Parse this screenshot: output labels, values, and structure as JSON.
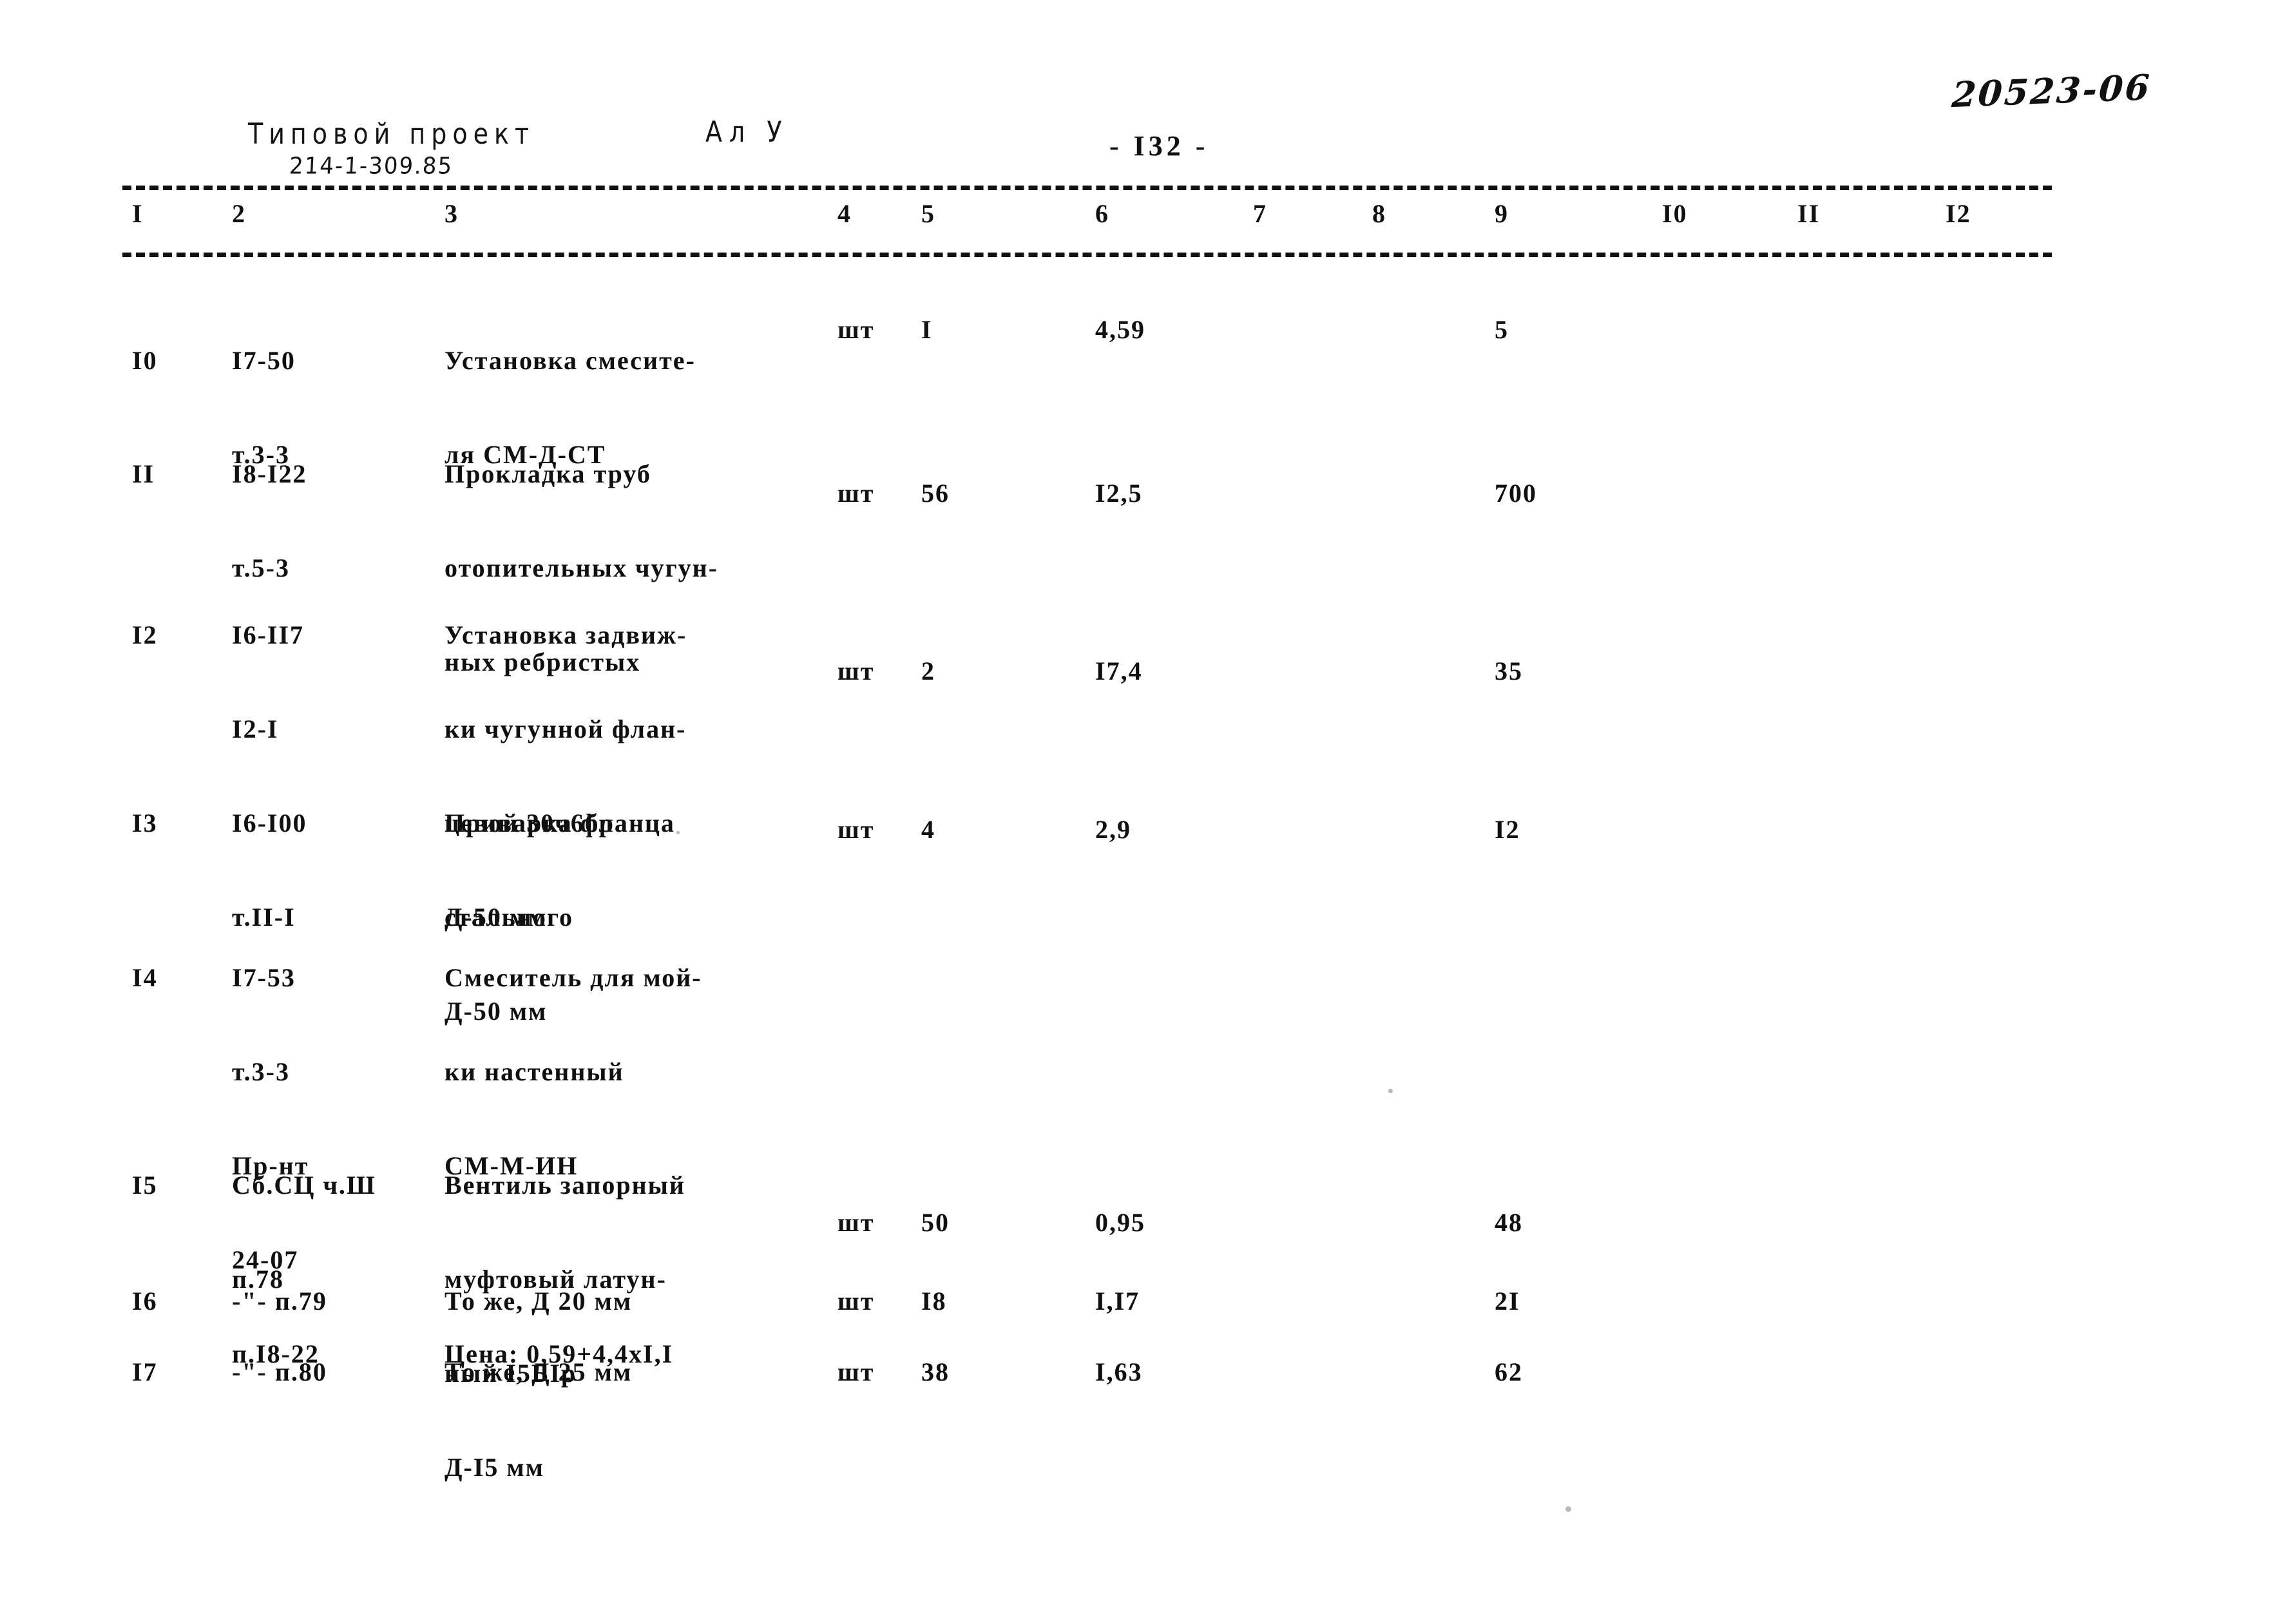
{
  "document": {
    "archive_stamp": "20523-06",
    "form_header_label": "Типовой проект",
    "project_code": "214-1-309.85",
    "album_label": "Ал У",
    "page_number": "- I32 -"
  },
  "table": {
    "column_headers": [
      "I",
      "2",
      "3",
      "4",
      "5",
      "6",
      "7",
      "8",
      "9",
      "I0",
      "II",
      "I2"
    ],
    "rows": [
      {
        "c1": "I0",
        "c2": [
          "I7-50",
          "т.3-3"
        ],
        "c3": [
          "Установка смесите-",
          "ля СМ-Д-СТ"
        ],
        "c4": "шт",
        "c5": "I",
        "c6": "4,59",
        "c7": "",
        "c8": "",
        "c9": "5",
        "c10": "",
        "c11": "",
        "c12": ""
      },
      {
        "c1": "II",
        "c2": [
          "I8-I22",
          "т.5-3"
        ],
        "c3": [
          "Прокладка труб",
          "отопительных чугун-",
          "ных ребристых"
        ],
        "c4": "шт",
        "c5": "56",
        "c6": "I2,5",
        "c7": "",
        "c8": "",
        "c9": "700",
        "c10": "",
        "c11": "",
        "c12": ""
      },
      {
        "c1": "I2",
        "c2": [
          "I6-II7",
          "I2-I"
        ],
        "c3": [
          "Установка задвиж-",
          "ки чугунной флан-",
          "цевой 30ч6бр",
          "Д-50 мм"
        ],
        "c4": "шт",
        "c5": "2",
        "c6": "I7,4",
        "c7": "",
        "c8": "",
        "c9": "35",
        "c10": "",
        "c11": "",
        "c12": ""
      },
      {
        "c1": "I3",
        "c2": [
          "I6-I00",
          "т.II-I"
        ],
        "c3": [
          "Приварка фланца",
          "стального",
          "Д-50 мм"
        ],
        "c4": "шт",
        "c5": "4",
        "c6": "2,9",
        "c7": "",
        "c8": "",
        "c9": "I2",
        "c10": "",
        "c11": "",
        "c12": ""
      },
      {
        "c1": "I4",
        "c2": [
          "I7-53",
          "т.3-3",
          "Пр-нт",
          "24-07",
          "п.I8-22"
        ],
        "c3": [
          "Смеситель для мой-",
          "ки настенный",
          "СМ-М-ИН",
          "",
          "Цена: 0,59+4,4хI,I"
        ],
        "c4": "",
        "c5": "",
        "c6": "",
        "c7": "",
        "c8": "",
        "c9": "",
        "c10": "",
        "c11": "",
        "c12": ""
      },
      {
        "c1": "I5",
        "c2": [
          "Сб.СЦ ч.Ш",
          "п.78"
        ],
        "c3": [
          "Вентиль запорный",
          "муфтовый латун-",
          "ный I5БIр",
          "Д-I5 мм"
        ],
        "c4": "шт",
        "c5": "50",
        "c6": "0,95",
        "c7": "",
        "c8": "",
        "c9": "48",
        "c10": "",
        "c11": "",
        "c12": ""
      },
      {
        "c1": "I6",
        "c2": [
          "-\"- п.79"
        ],
        "c3": [
          "То же, Д 20 мм"
        ],
        "c4": "шт",
        "c5": "I8",
        "c6": "I,I7",
        "c7": "",
        "c8": "",
        "c9": "2I",
        "c10": "",
        "c11": "",
        "c12": ""
      },
      {
        "c1": "I7",
        "c2": [
          "-\"- п.80"
        ],
        "c3": [
          "То же, Д 25 мм"
        ],
        "c4": "шт",
        "c5": "38",
        "c6": "I,63",
        "c7": "",
        "c8": "",
        "c9": "62",
        "c10": "",
        "c11": "",
        "c12": ""
      }
    ]
  }
}
